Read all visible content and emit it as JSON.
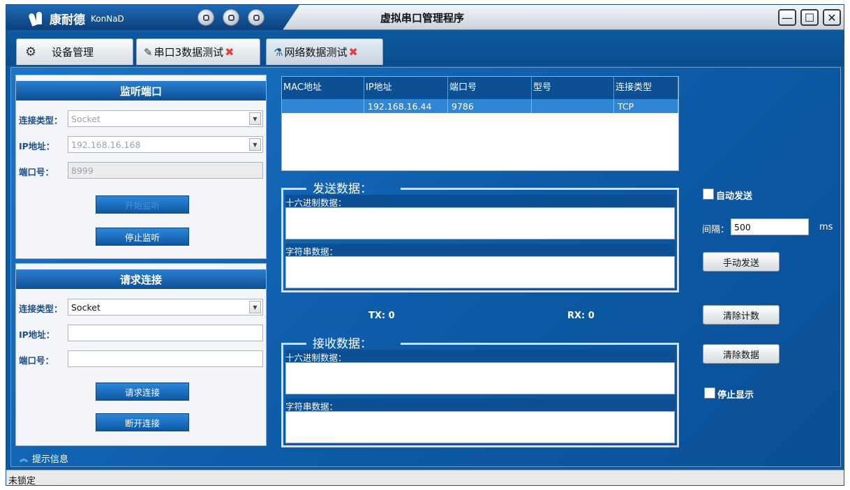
{
  "window": {
    "logo_text": "康耐德",
    "logo_latin": "KonNaD",
    "title": "虚拟串口管理程序",
    "controls": {
      "minimize": "—",
      "maximize": "☐",
      "close": "✕"
    }
  },
  "tabs": [
    {
      "label": "设备管理"
    },
    {
      "label": "串口3数据测试"
    },
    {
      "label": "网络数据测试"
    }
  ],
  "listen_panel": {
    "title": "监听端口",
    "conn_type_label": "连接类型：",
    "conn_type_value": "Socket",
    "ip_label": "IP地址：",
    "ip_value": "192.168.16.168",
    "port_label": "端口号：",
    "port_value": "8999",
    "start_button": "开始监听",
    "stop_button": "停止监听"
  },
  "request_panel": {
    "title": "请求连接",
    "conn_type_label": "连接类型：",
    "conn_type_value": "Socket",
    "ip_label": "IP地址：",
    "ip_value": "",
    "port_label": "端口号：",
    "port_value": "",
    "request_button": "请求连接",
    "disconnect_button": "断开连接"
  },
  "tip": {
    "label": "提示信息"
  },
  "table": {
    "headers": [
      "MAC地址",
      "IP地址",
      "端口号",
      "型号",
      "连接类型"
    ],
    "rows": [
      [
        "",
        "192.168.16.44",
        "9786",
        "",
        "TCP"
      ]
    ]
  },
  "send": {
    "title": "发送数据：",
    "hex_label": "十六进制数据：",
    "str_label": "字符串数据："
  },
  "receive": {
    "title": "接收数据：",
    "hex_label": "十六进制数据：",
    "str_label": "字符串数据："
  },
  "counters": {
    "tx": "TX: 0",
    "rx": "RX: 0"
  },
  "right_controls": {
    "auto_send_label": "自动发送",
    "interval_label": "间隔：",
    "interval_value": "500",
    "interval_unit": "ms",
    "manual_send": "手动发送",
    "clear_count": "清除计数",
    "clear_data": "清除数据",
    "stop_display_label": "停止显示"
  },
  "status": {
    "text": "未锁定"
  },
  "colors": {
    "accent": "#0d5aa0",
    "header": "#0c4f92",
    "selected_row": "#2f86d4",
    "close_x": "#e04040"
  }
}
